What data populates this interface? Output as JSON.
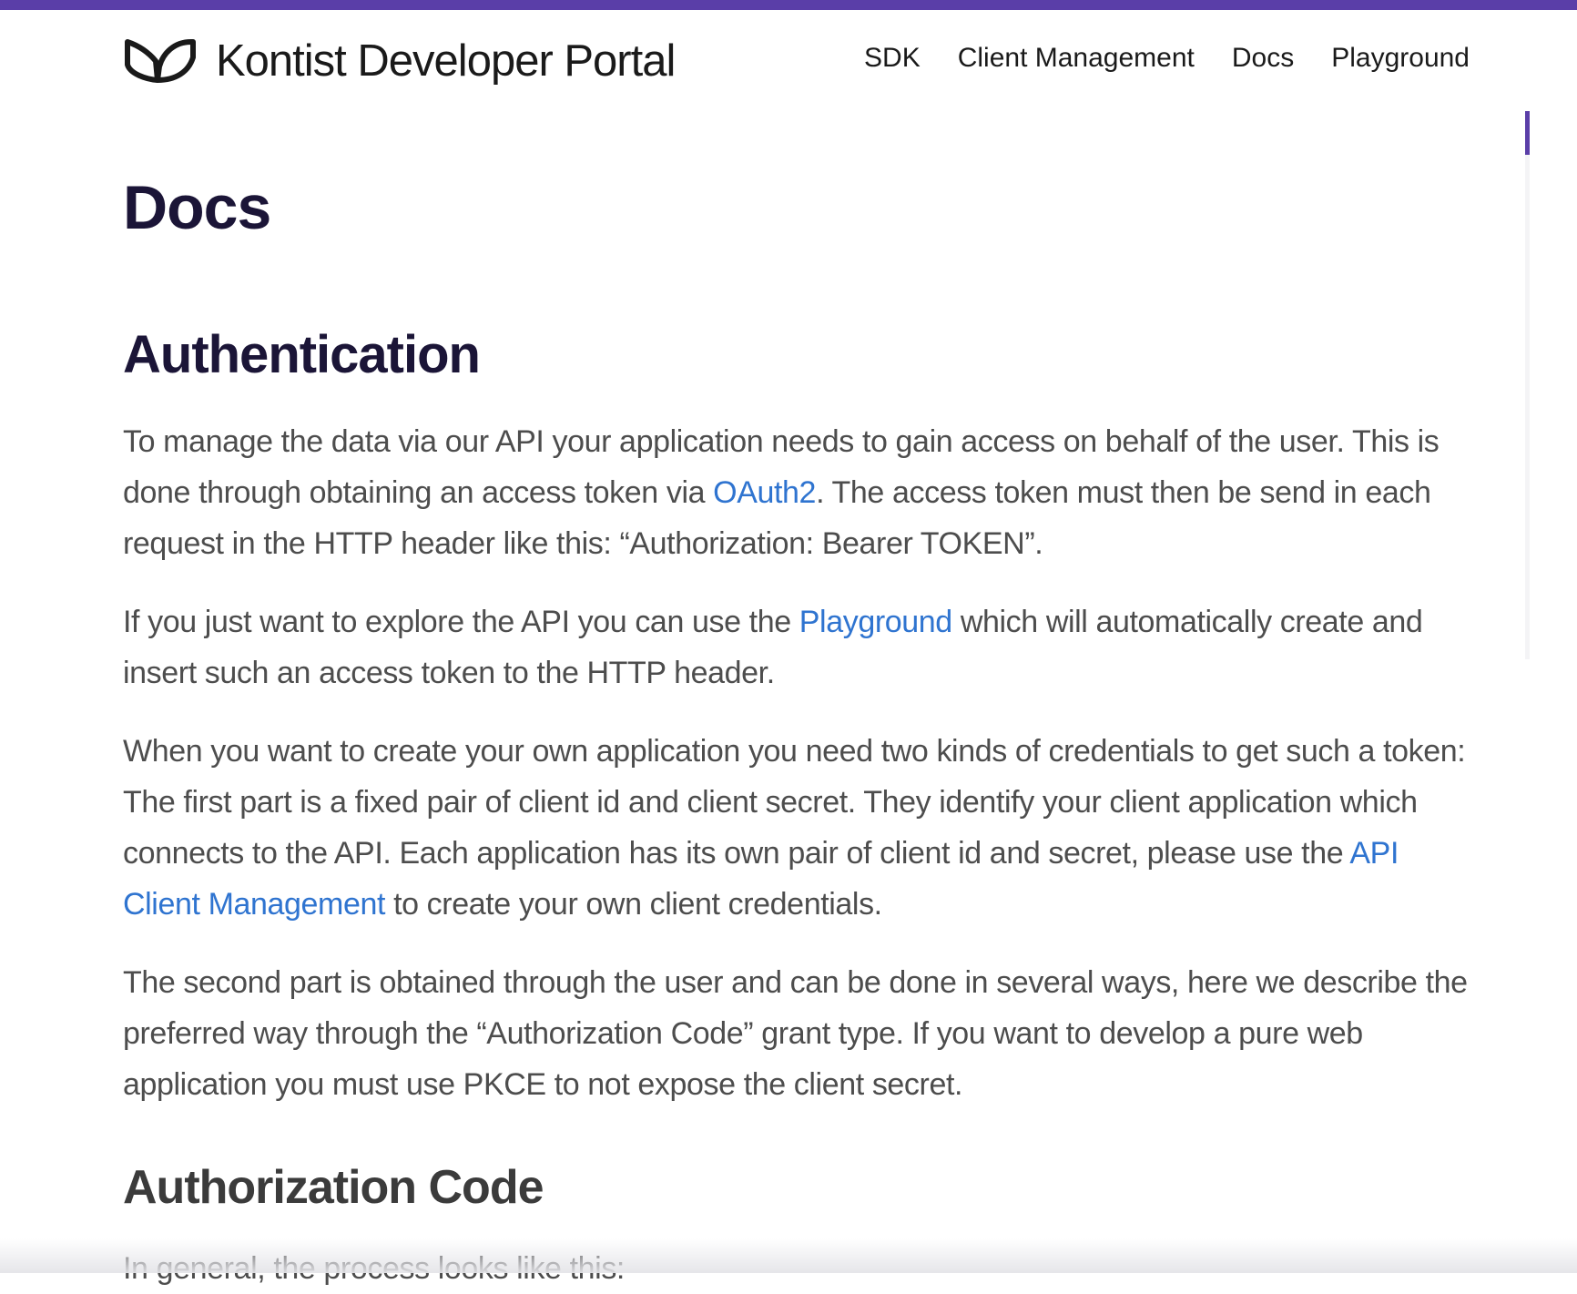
{
  "brand": {
    "logo_icon": "kontist-leaf-logo-icon",
    "title": "Kontist Developer Portal",
    "accent_color": "#5a3ea8",
    "link_color": "#2f74d0"
  },
  "nav": {
    "items": [
      {
        "label": "SDK"
      },
      {
        "label": "Client Management"
      },
      {
        "label": "Docs"
      },
      {
        "label": "Playground"
      }
    ]
  },
  "page": {
    "title": "Docs"
  },
  "authentication": {
    "heading": "Authentication",
    "p1": {
      "before": "To manage the data via our API your application needs to gain access on behalf of the user. This is done through obtaining an access token via ",
      "link": "OAuth2",
      "after": ". The access token must then be send in each request in the HTTP header like this: “Authorization: Bearer TOKEN”."
    },
    "p2": {
      "before": "If you just want to explore the API you can use the ",
      "link": "Playground",
      "after": " which will automatically create and insert such an access token to the HTTP header."
    },
    "p3": {
      "before": "When you want to create your own application you need two kinds of credentials to get such a token: The first part is a fixed pair of client id and client secret. They identify your client application which connects to the API. Each application has its own pair of client id and secret, please use the ",
      "link": "API Client Management",
      "after": " to create your own client credentials."
    },
    "p4": "The second part is obtained through the user and can be done in several ways, here we describe the preferred way through the “Authorization Code” grant type. If you want to develop a pure web application you must use PKCE to not expose the client secret."
  },
  "authorization_code": {
    "heading": "Authorization Code",
    "intro": "In general, the process looks like this:"
  }
}
